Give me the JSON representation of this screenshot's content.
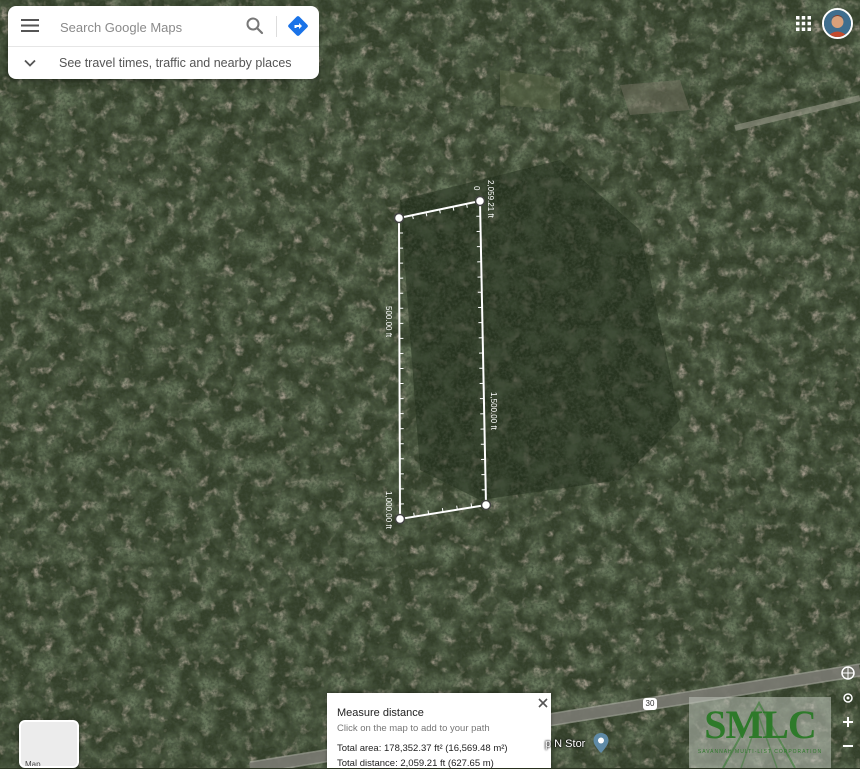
{
  "search": {
    "placeholder": "Search Google Maps",
    "travel_text": "See travel times, traffic and nearby places"
  },
  "map": {
    "polygon_labels": {
      "top_edge": "2,059.21 ft",
      "left_edge": "500.00 ft",
      "right_edge": "1,500.00 ft",
      "bottom_edge": "1,000.00 ft",
      "start_marker": "0"
    },
    "place_label": "p N Stor",
    "route_number": "30",
    "layer_toggle_label": "Map"
  },
  "measure": {
    "title": "Measure distance",
    "hint": "Click on the map to add to your path",
    "area": "Total area: 178,352.37 ft² (16,569.48 m²)",
    "distance": "Total distance: 2,059.21 ft (627.65 m)"
  },
  "watermark": {
    "logo_text": "SMLC",
    "logo_subtext": "SAVANNAH MULTI-LIST CORPORATION"
  },
  "icons": [
    "menu-icon",
    "search-icon",
    "directions-icon",
    "chevron-down-icon",
    "apps-grid-icon",
    "avatar",
    "close-icon",
    "place-pin-icon",
    "compass-icon",
    "location-icon",
    "zoom-in-icon",
    "zoom-out-icon"
  ],
  "colors": {
    "measure_line": "#ffffff",
    "directions_blue": "#1a73e8",
    "forest": "#2e3a24",
    "logo_green": "#2e7a2a"
  }
}
